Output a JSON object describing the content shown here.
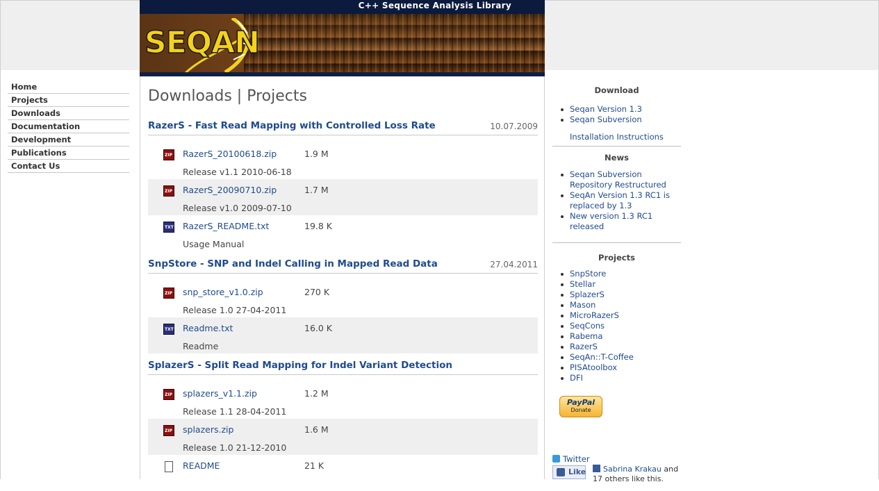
{
  "banner": {
    "tagline": "C++ Sequence Analysis Library",
    "logo": "SEQAN"
  },
  "nav": [
    "Home",
    "Projects",
    "Downloads",
    "Documentation",
    "Development",
    "Publications",
    "Contact Us"
  ],
  "main": {
    "title": "Downloads | Projects",
    "sections": [
      {
        "title": "RazerS - Fast Read Mapping with Controlled Loss Rate",
        "date": "10.07.2009",
        "files": [
          {
            "icon": "zip-file-icon",
            "name": "RazerS_20100618.zip",
            "size": "1.9 M",
            "desc": "Release v1.1 2010-06-18"
          },
          {
            "icon": "zip-file-icon",
            "name": "RazerS_20090710.zip",
            "size": "1.7 M",
            "desc": "Release v1.0 2009-07-10"
          },
          {
            "icon": "txt-file-icon",
            "name": "RazerS_README.txt",
            "size": "19.8 K",
            "desc": "Usage Manual"
          }
        ]
      },
      {
        "title": "SnpStore - SNP and Indel Calling in Mapped Read Data",
        "date": "27.04.2011",
        "files": [
          {
            "icon": "zip-file-icon",
            "name": "snp_store_v1.0.zip",
            "size": "270 K",
            "desc": "Release 1.0 27-04-2011"
          },
          {
            "icon": "txt-file-icon",
            "name": "Readme.txt",
            "size": "16.0 K",
            "desc": "Readme"
          }
        ]
      },
      {
        "title": "SplazerS - Split Read Mapping for Indel Variant Detection",
        "date": "",
        "files": [
          {
            "icon": "zip-file-icon",
            "name": "splazers_v1.1.zip",
            "size": "1.2 M",
            "desc": "Release 1.1 28-04-2011"
          },
          {
            "icon": "zip-file-icon",
            "name": "splazers.zip",
            "size": "1.6 M",
            "desc": "Release 1.0 21-12-2010"
          },
          {
            "icon": "document-icon",
            "name": "README",
            "size": "21 K",
            "desc": ""
          }
        ]
      }
    ]
  },
  "sidebar": {
    "download": {
      "heading": "Download",
      "items": [
        "Seqan Version 1.3",
        "Seqan Subversion"
      ],
      "extra": "Installation Instructions"
    },
    "news": {
      "heading": "News",
      "items": [
        "Seqan Subversion Repository Restructured",
        "SeqAn Version 1.3 RC1 is replaced by 1.3",
        "New version 1.3 RC1 released"
      ]
    },
    "projects": {
      "heading": "Projects",
      "items": [
        "SnpStore",
        "Stellar",
        "SplazerS",
        "Mason",
        "MicroRazerS",
        "SeqCons",
        "Rabema",
        "RazerS",
        "SeqAn::T-Coffee",
        "PISAtoolbox",
        "DFI"
      ]
    },
    "paypal": {
      "brand": "PayPal",
      "label": "Donate"
    },
    "twitter": "Twitter",
    "like_button": "Like",
    "facebook": {
      "name": "Sabrina Krakau",
      "text": " and 17 others like this."
    }
  }
}
